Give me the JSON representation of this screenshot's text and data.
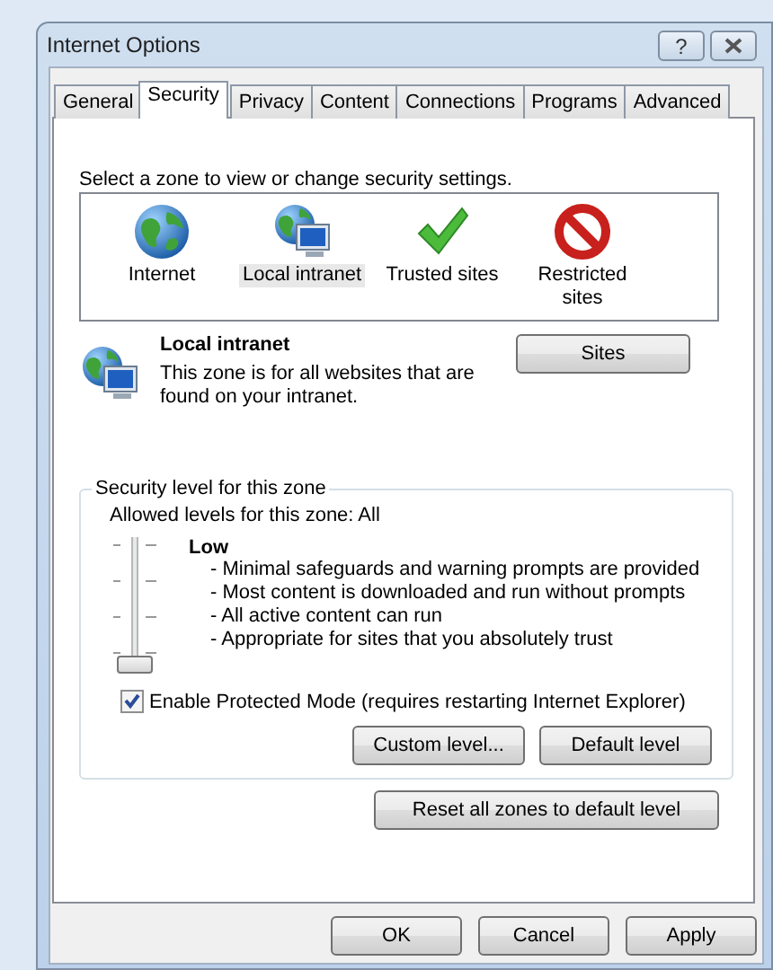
{
  "window": {
    "title": "Internet Options",
    "help": "?"
  },
  "tabs": [
    {
      "label": "General",
      "selected": false
    },
    {
      "label": "Security",
      "selected": true
    },
    {
      "label": "Privacy",
      "selected": false
    },
    {
      "label": "Content",
      "selected": false
    },
    {
      "label": "Connections",
      "selected": false
    },
    {
      "label": "Programs",
      "selected": false
    },
    {
      "label": "Advanced",
      "selected": false
    }
  ],
  "zone_prompt": "Select a zone to view or change security settings.",
  "zones": [
    {
      "label": "Internet",
      "kind": "globe",
      "selected": false
    },
    {
      "label": "Local intranet",
      "kind": "network",
      "selected": true
    },
    {
      "label": "Trusted sites",
      "kind": "check",
      "selected": false
    },
    {
      "label": "Restricted sites",
      "kind": "blocked",
      "selected": false
    }
  ],
  "zone_detail": {
    "title": "Local intranet",
    "description": "This zone is for all websites that are found on your intranet.",
    "button": "Sites"
  },
  "security_level": {
    "legend": "Security level for this zone",
    "allowed": "Allowed levels for this zone: All",
    "slider": {
      "level": 0
    },
    "level_name": "Low",
    "bullets": [
      "- Minimal safeguards and warning prompts are provided",
      "- Most content is downloaded and run without prompts",
      "- All active content can run",
      "- Appropriate for sites that you absolutely trust"
    ],
    "protected_mode": {
      "label": "Enable Protected Mode (requires restarting Internet Explorer)",
      "checked": true
    },
    "buttons": [
      "Custom level...",
      "Default level"
    ]
  },
  "reset_button": "Reset all zones to default level",
  "dialog_buttons": [
    "OK",
    "Cancel",
    "Apply"
  ]
}
